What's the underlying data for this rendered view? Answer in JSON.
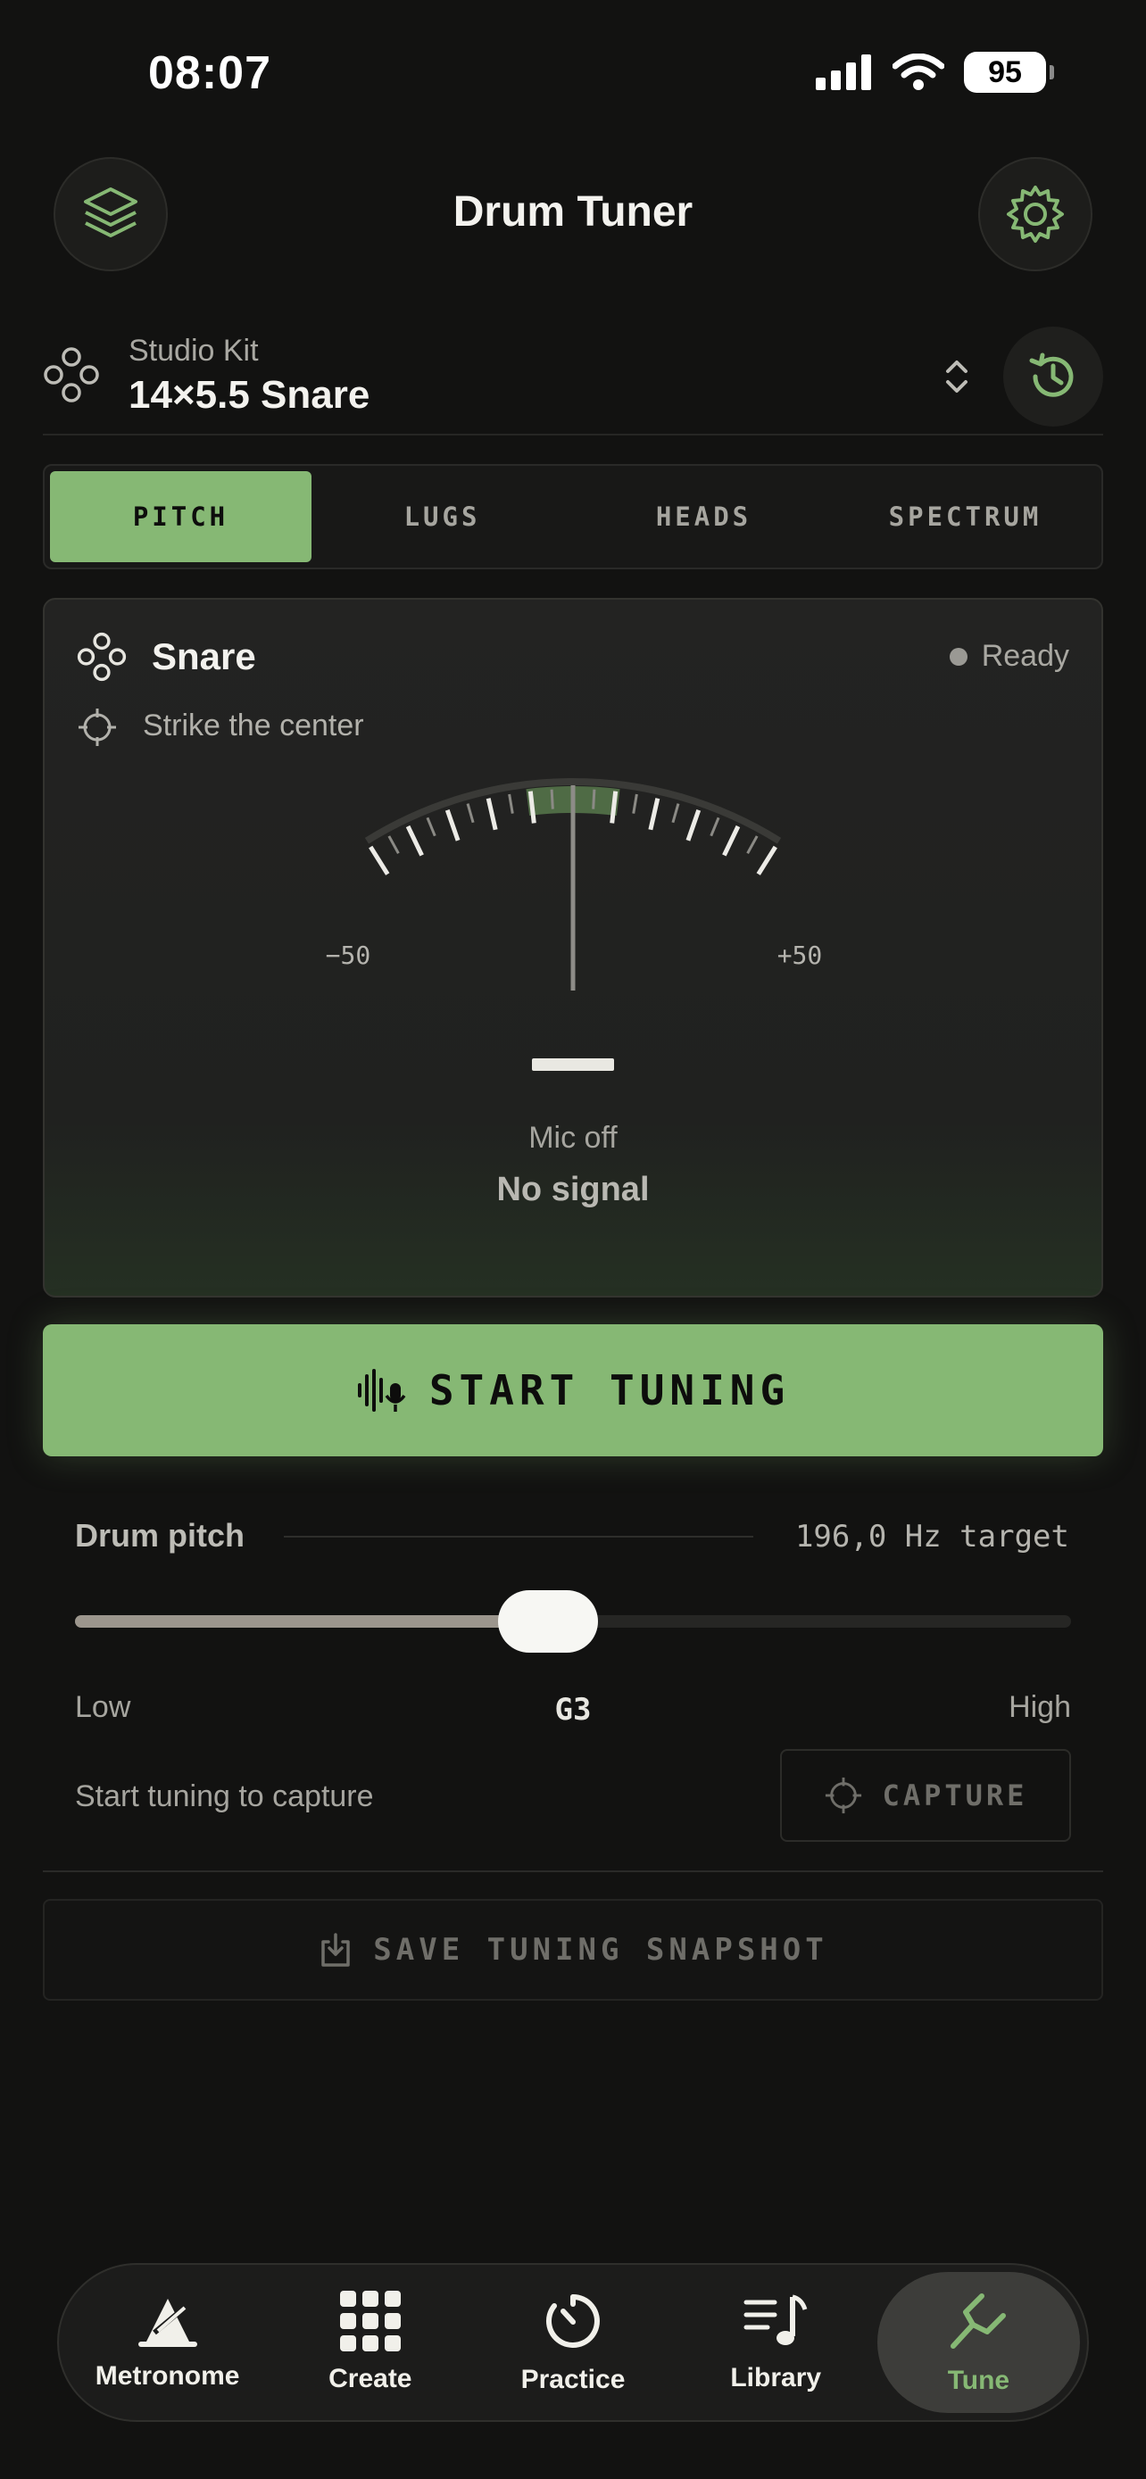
{
  "status_bar": {
    "time": "08:07",
    "battery": "95"
  },
  "header": {
    "title": "Drum Tuner",
    "left_icon": "layers-icon",
    "right_icon": "gear-icon"
  },
  "kit": {
    "label": "Studio Kit",
    "name": "14×5.5 Snare"
  },
  "tabs": [
    {
      "label": "PITCH",
      "active": true
    },
    {
      "label": "LUGS",
      "active": false
    },
    {
      "label": "HEADS",
      "active": false
    },
    {
      "label": "SPECTRUM",
      "active": false
    }
  ],
  "tuner": {
    "drum": "Snare",
    "status": "Ready",
    "hint": "Strike the center",
    "gauge_min_label": "−50",
    "gauge_max_label": "+50",
    "cents_offset": 0,
    "note_display": "—",
    "mic_state": "Mic off",
    "signal_state": "No signal"
  },
  "start_button": {
    "label": "START TUNING"
  },
  "pitch": {
    "label": "Drum pitch",
    "target": "196,0 Hz target",
    "slider_fraction": 0.475,
    "low_label": "Low",
    "note": "G3",
    "high_label": "High",
    "capture_hint": "Start tuning to capture",
    "capture_label": "CAPTURE"
  },
  "save_button": {
    "label": "SAVE TUNING SNAPSHOT"
  },
  "bottom_nav": [
    {
      "label": "Metronome",
      "icon": "metronome-icon",
      "active": false
    },
    {
      "label": "Create",
      "icon": "grid-icon",
      "active": false
    },
    {
      "label": "Practice",
      "icon": "timer-icon",
      "active": false
    },
    {
      "label": "Library",
      "icon": "music-list-icon",
      "active": false
    },
    {
      "label": "Tune",
      "icon": "tuning-fork-icon",
      "active": true
    }
  ],
  "colors": {
    "accent": "#86b874",
    "background": "#121211",
    "card": "#222221"
  }
}
